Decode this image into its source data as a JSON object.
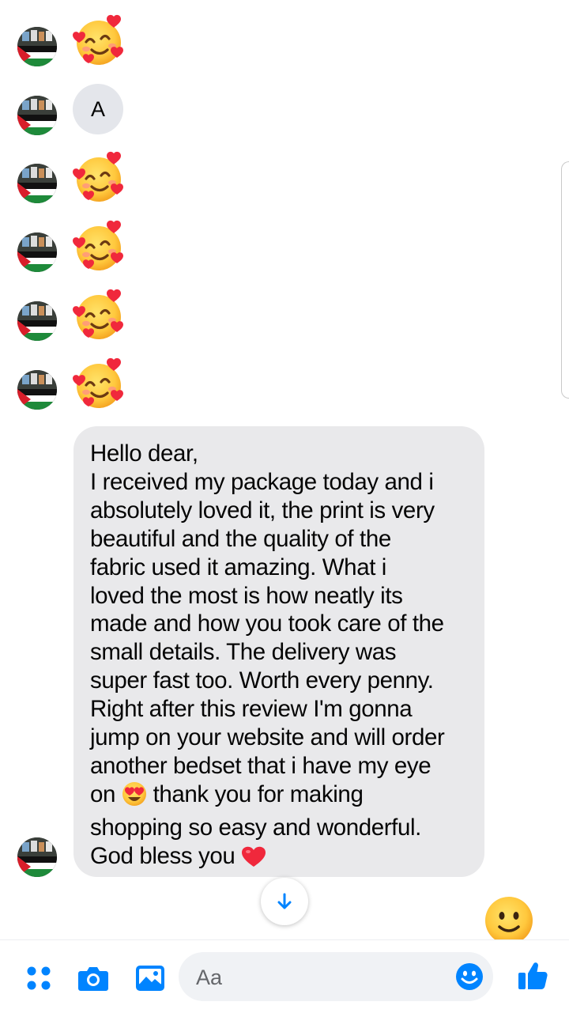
{
  "conversation": {
    "messages": [
      {
        "kind": "emoji",
        "icon": "smiling-face-with-hearts-icon"
      },
      {
        "kind": "text",
        "text": "A"
      },
      {
        "kind": "emoji",
        "icon": "smiling-face-with-hearts-icon"
      },
      {
        "kind": "emoji",
        "icon": "smiling-face-with-hearts-icon"
      },
      {
        "kind": "emoji",
        "icon": "smiling-face-with-hearts-icon"
      },
      {
        "kind": "emoji",
        "icon": "smiling-face-with-hearts-icon"
      }
    ],
    "letter_message": "A",
    "long_message": {
      "lines": [
        "Hello dear,",
        "I received my package today and i",
        "absolutely loved it, the print is very",
        "beautiful and the quality of the",
        "fabric used it amazing. What i",
        "loved the most is how neatly its",
        "made and how you took care of the",
        "small details. The delivery was",
        "super fast too. Worth every penny.",
        "Right after this review I'm gonna",
        "jump on your website and will order",
        "another bedset that i have my eye"
      ],
      "line_13_before_emoji": "on",
      "line_13_after_emoji": "thank you for making",
      "line_14": "shopping so easy and wonderful.",
      "line_15": "God bless you",
      "inline_emojis": [
        "heart-eyes-icon",
        "red-heart-icon"
      ]
    }
  },
  "composer": {
    "placeholder": "Aa",
    "icons": [
      "menu-dots-icon",
      "camera-icon",
      "gallery-icon",
      "emoji-icon",
      "like-thumb-icon"
    ]
  },
  "colors": {
    "messenger_blue": "#0084ff",
    "bubble_gray": "#e9e9eb",
    "input_gray": "#f0f2f5"
  }
}
